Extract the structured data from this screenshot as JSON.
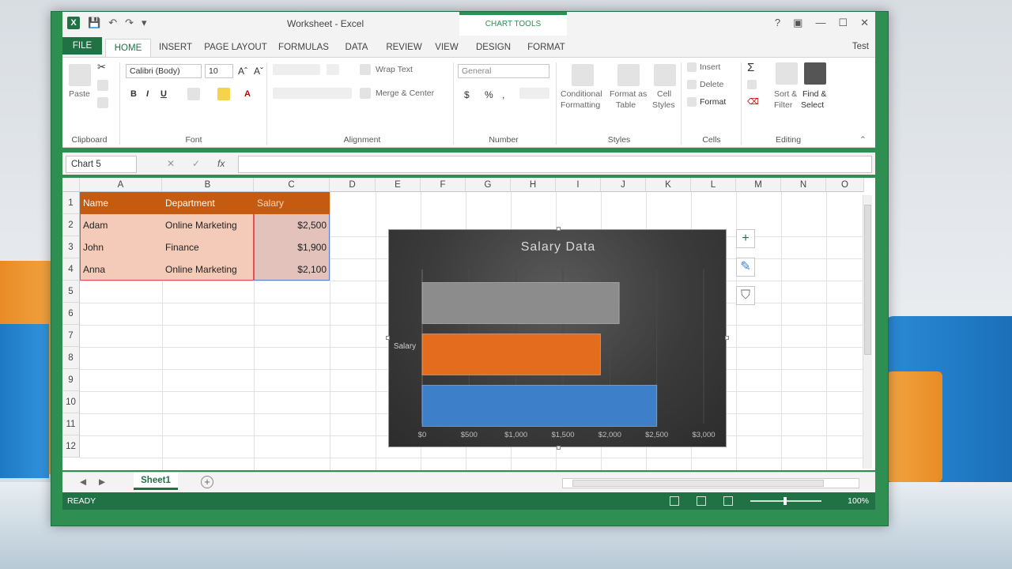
{
  "window": {
    "title": "Worksheet - Excel",
    "user": "Test",
    "chart_tools_label": "CHART TOOLS"
  },
  "ribbon_tabs": [
    "FILE",
    "HOME",
    "INSERT",
    "PAGE LAYOUT",
    "FORMULAS",
    "DATA",
    "REVIEW",
    "VIEW"
  ],
  "context_tabs": [
    "DESIGN",
    "FORMAT"
  ],
  "ribbon": {
    "clipboard": {
      "label": "Clipboard",
      "paste": "Paste"
    },
    "font": {
      "label": "Font",
      "name": "Calibri (Body)",
      "size": "10",
      "bold": "B",
      "italic": "I",
      "underline": "U"
    },
    "alignment": {
      "label": "Alignment",
      "wrap": "Wrap Text",
      "merge": "Merge & Center"
    },
    "number": {
      "label": "Number",
      "format": "General",
      "currency": "$",
      "percent": "%",
      "comma": ","
    },
    "styles": {
      "label": "Styles",
      "conditional": "Conditional",
      "conditional2": "Formatting",
      "format_table": "Format as",
      "format_table2": "Table",
      "cell_styles": "Cell",
      "cell_styles2": "Styles"
    },
    "cells": {
      "label": "Cells",
      "insert": "Insert",
      "delete": "Delete",
      "format": "Format"
    },
    "editing": {
      "label": "Editing",
      "sort": "Sort &",
      "sort2": "Filter",
      "find": "Find &",
      "find2": "Select"
    }
  },
  "formula_bar": {
    "name_box": "Chart 5",
    "cancel": "✕",
    "enter": "✓",
    "fx": "fx",
    "value": ""
  },
  "columns": [
    "A",
    "B",
    "C",
    "D",
    "E",
    "F",
    "G",
    "H",
    "I",
    "J",
    "K",
    "L",
    "M",
    "N",
    "O"
  ],
  "rows": [
    "1",
    "2",
    "3",
    "4",
    "5",
    "6",
    "7",
    "8",
    "9",
    "10",
    "11",
    "12"
  ],
  "table": {
    "headers": [
      "Name",
      "Department",
      "Salary"
    ],
    "rows": [
      [
        "Adam",
        "Online Marketing",
        "$2,500"
      ],
      [
        "John",
        "Finance",
        "$1,900"
      ],
      [
        "Anna",
        "Online Marketing",
        "$2,100"
      ]
    ]
  },
  "chart_data": {
    "type": "bar",
    "title": "Salary Data",
    "category_label": "Salary",
    "series": [
      {
        "value": 2100,
        "color": "#8c8c8c"
      },
      {
        "value": 1900,
        "color": "#e36c1e"
      },
      {
        "value": 2500,
        "color": "#3d7fc9"
      }
    ],
    "xlim": [
      0,
      3000
    ],
    "ticks": [
      "$0",
      "$500",
      "$1,000",
      "$1,500",
      "$2,000",
      "$2,500",
      "$3,000"
    ],
    "tick_values": [
      0,
      500,
      1000,
      1500,
      2000,
      2500,
      3000
    ]
  },
  "chart_buttons": [
    "+",
    "✎",
    "⛉"
  ],
  "sheet": {
    "tab": "Sheet1",
    "add": "+"
  },
  "status": {
    "ready": "READY",
    "zoom": "100%"
  },
  "colors": {
    "accent": "#207245",
    "header_fill": "#c55a11",
    "data_fill": "#f4cbb8"
  }
}
